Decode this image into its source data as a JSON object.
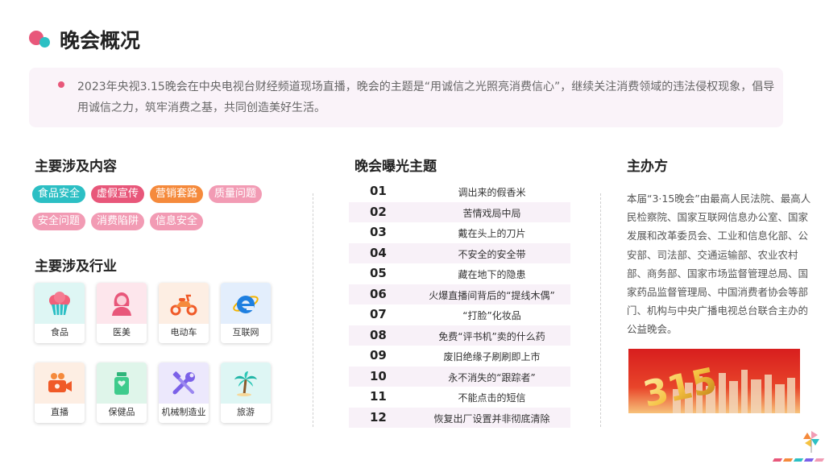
{
  "header": {
    "title": "晚会概况"
  },
  "intro": {
    "text": "2023年央视3.15晚会在中央电视台财经频道现场直播，晚会的主题是“用诚信之光照亮消费信心”，继续关注消费领域的违法侵权现象，倡导用诚信之力，筑牢消费之基，共同创造美好生活。"
  },
  "content_section": {
    "title": "主要涉及内容",
    "tags": [
      {
        "label": "食品安全",
        "color": "#2cbfc4"
      },
      {
        "label": "虚假宣传",
        "color": "#e8577a"
      },
      {
        "label": "营销套路",
        "color": "#f58a3c"
      },
      {
        "label": "质量问题",
        "color": "#f29bb4"
      },
      {
        "label": "安全问题",
        "color": "#f29bb4"
      },
      {
        "label": "消费陷阱",
        "color": "#f29bb4"
      },
      {
        "label": "信息安全",
        "color": "#f29bb4"
      }
    ]
  },
  "industry_section": {
    "title": "主要涉及行业",
    "items": [
      {
        "label": "食品",
        "icon": "cupcake-icon",
        "bg": "#def6f4"
      },
      {
        "label": "医美",
        "icon": "woman-icon",
        "bg": "#fde6ec"
      },
      {
        "label": "电动车",
        "icon": "scooter-icon",
        "bg": "#fdeee3"
      },
      {
        "label": "互联网",
        "icon": "internet-explorer-icon",
        "bg": "#e3eefc"
      },
      {
        "label": "直播",
        "icon": "video-camera-icon",
        "bg": "#fdeee3"
      },
      {
        "label": "保健品",
        "icon": "supplement-bottle-icon",
        "bg": "#dff5ea"
      },
      {
        "label": "机械制造业",
        "icon": "tools-icon",
        "bg": "#ece8fc"
      },
      {
        "label": "旅游",
        "icon": "palm-tree-icon",
        "bg": "#def6f4"
      }
    ]
  },
  "topics_section": {
    "title": "晚会曝光主题",
    "items": [
      {
        "num": "01",
        "text": "调出来的假香米"
      },
      {
        "num": "02",
        "text": "苦情戏局中局"
      },
      {
        "num": "03",
        "text": "戴在头上的刀片"
      },
      {
        "num": "04",
        "text": "不安全的安全带"
      },
      {
        "num": "05",
        "text": "藏在地下的隐患"
      },
      {
        "num": "06",
        "text": "火爆直播间背后的“提线木偶”"
      },
      {
        "num": "07",
        "text": "“打脸”化妆品"
      },
      {
        "num": "08",
        "text": "免费“评书机”卖的什么药"
      },
      {
        "num": "09",
        "text": "废旧绝缘子刷刷即上市"
      },
      {
        "num": "10",
        "text": "永不消失的“跟踪者”"
      },
      {
        "num": "11",
        "text": "不能点击的短信"
      },
      {
        "num": "12",
        "text": "恢复出厂设置并非彻底清除"
      }
    ]
  },
  "organizer_section": {
    "title": "主办方",
    "text": "本届“3·15晚会”由最高人民法院、最高人民检察院、国家互联网信息办公室、国家发展和改革委员会、工业和信息化部、公安部、司法部、交通运输部、农业农村部、商务部、国家市场监督管理总局、国家药品监督管理局、中国消费者协会等部门、机构与中央广播电视总台联合主办的公益晚会。",
    "image_caption": "315"
  },
  "colors": {
    "accent_red": "#e8577a",
    "accent_teal": "#2cc0c4",
    "accent_orange": "#f58a3c"
  }
}
